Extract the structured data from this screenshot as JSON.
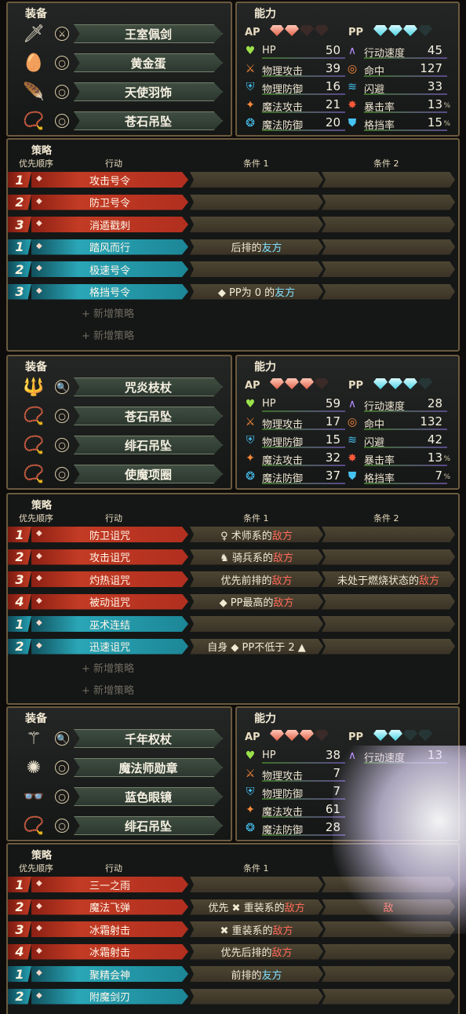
{
  "chars": [
    {
      "equip_title": "装备",
      "ability_title": "能力",
      "items": [
        {
          "icon": "sword-icon",
          "glyph": "🗡",
          "slot": "⚔",
          "name": "王室佩剑"
        },
        {
          "icon": "egg-icon",
          "glyph": "🥚",
          "slot": "○",
          "name": "黄金蛋"
        },
        {
          "icon": "feather-icon",
          "glyph": "🪶",
          "slot": "○",
          "name": "天使羽饰"
        },
        {
          "icon": "pendant-icon",
          "glyph": "📿",
          "slot": "○",
          "name": "苍石吊坠"
        }
      ],
      "ap_label": "AP",
      "pp_label": "PP",
      "ap_gems": [
        "full",
        "full",
        "empty",
        "empty"
      ],
      "pp_gems": [
        "full",
        "full",
        "full",
        "empty"
      ],
      "stats": [
        {
          "name": "HP",
          "value": "50",
          "icon": "heart-icon",
          "glyph": "♥",
          "color": "#9be24a",
          "unit": ""
        },
        {
          "name": "物理攻击",
          "value": "39",
          "icon": "sword-icon",
          "glyph": "⚔",
          "color": "#ff8a3a",
          "unit": ""
        },
        {
          "name": "物理防御",
          "value": "16",
          "icon": "armor-icon",
          "glyph": "⛨",
          "color": "#46c3f2",
          "unit": ""
        },
        {
          "name": "魔法攻击",
          "value": "21",
          "icon": "staff-icon",
          "glyph": "✦",
          "color": "#ff8a3a",
          "unit": ""
        },
        {
          "name": "魔法防御",
          "value": "20",
          "icon": "magic-shield-icon",
          "glyph": "❂",
          "color": "#46c3f2",
          "unit": ""
        },
        {
          "name": "行动速度",
          "value": "45",
          "icon": "speed-icon",
          "glyph": "∧",
          "color": "#b48cff",
          "unit": ""
        },
        {
          "name": "命中",
          "value": "127",
          "icon": "target-icon",
          "glyph": "◎",
          "color": "#ff8a3a",
          "unit": ""
        },
        {
          "name": "闪避",
          "value": "33",
          "icon": "evasion-icon",
          "glyph": "≋",
          "color": "#46c3f2",
          "unit": ""
        },
        {
          "name": "暴击率",
          "value": "13",
          "icon": "crit-icon",
          "glyph": "✸",
          "color": "#ff5a3a",
          "unit": "%"
        },
        {
          "name": "格挡率",
          "value": "15",
          "icon": "block-icon",
          "glyph": "⛊",
          "color": "#46c3f2",
          "unit": "%"
        }
      ],
      "strategy_title": "策略",
      "col_priority": "优先顺序",
      "col_action": "行动",
      "col_cond1": "条件 1",
      "col_cond2": "条件 2",
      "rows": [
        {
          "type": "red",
          "prio": "1",
          "action": "攻击号令",
          "c1": "",
          "c1hl": "",
          "c2": "",
          "c2hl": ""
        },
        {
          "type": "red",
          "prio": "2",
          "action": "防卫号令",
          "c1": "",
          "c1hl": "",
          "c2": "",
          "c2hl": ""
        },
        {
          "type": "red",
          "prio": "3",
          "action": "消遁戳刺",
          "c1": "",
          "c1hl": "",
          "c2": "",
          "c2hl": ""
        },
        {
          "type": "blue",
          "prio": "1",
          "action": "踏风而行",
          "c1": "后排的",
          "c1hl": "友方",
          "c2": "",
          "c2hl": ""
        },
        {
          "type": "blue",
          "prio": "2",
          "action": "极速号令",
          "c1": "",
          "c1hl": "",
          "c2": "",
          "c2hl": ""
        },
        {
          "type": "blue",
          "prio": "3",
          "action": "格挡号令",
          "c1": "◆ PP为 0 的",
          "c1hl": "友方",
          "c2": "",
          "c2hl": ""
        }
      ],
      "add_labels": [
        "+ 新增策略",
        "+ 新增策略"
      ]
    },
    {
      "equip_title": "装备",
      "ability_title": "能力",
      "items": [
        {
          "icon": "staff-icon",
          "glyph": "🔱",
          "slot": "🔍",
          "name": "咒炎枝杖"
        },
        {
          "icon": "pendant-icon",
          "glyph": "📿",
          "slot": "○",
          "name": "苍石吊坠"
        },
        {
          "icon": "pendant-icon",
          "glyph": "📿",
          "slot": "○",
          "name": "绯石吊坠"
        },
        {
          "icon": "necklace-icon",
          "glyph": "📿",
          "slot": "○",
          "name": "使魔项圈"
        }
      ],
      "ap_label": "AP",
      "pp_label": "PP",
      "ap_gems": [
        "full",
        "full",
        "full",
        "empty"
      ],
      "pp_gems": [
        "full",
        "full",
        "full",
        "empty"
      ],
      "stats": [
        {
          "name": "HP",
          "value": "59",
          "icon": "heart-icon",
          "glyph": "♥",
          "color": "#9be24a",
          "unit": ""
        },
        {
          "name": "物理攻击",
          "value": "17",
          "icon": "sword-icon",
          "glyph": "⚔",
          "color": "#ff8a3a",
          "unit": ""
        },
        {
          "name": "物理防御",
          "value": "15",
          "icon": "armor-icon",
          "glyph": "⛨",
          "color": "#46c3f2",
          "unit": ""
        },
        {
          "name": "魔法攻击",
          "value": "32",
          "icon": "staff-icon",
          "glyph": "✦",
          "color": "#ff8a3a",
          "unit": ""
        },
        {
          "name": "魔法防御",
          "value": "37",
          "icon": "magic-shield-icon",
          "glyph": "❂",
          "color": "#46c3f2",
          "unit": ""
        },
        {
          "name": "行动速度",
          "value": "28",
          "icon": "speed-icon",
          "glyph": "∧",
          "color": "#b48cff",
          "unit": ""
        },
        {
          "name": "命中",
          "value": "132",
          "icon": "target-icon",
          "glyph": "◎",
          "color": "#ff8a3a",
          "unit": ""
        },
        {
          "name": "闪避",
          "value": "42",
          "icon": "evasion-icon",
          "glyph": "≋",
          "color": "#46c3f2",
          "unit": ""
        },
        {
          "name": "暴击率",
          "value": "13",
          "icon": "crit-icon",
          "glyph": "✸",
          "color": "#ff5a3a",
          "unit": "%"
        },
        {
          "name": "格挡率",
          "value": "7",
          "icon": "block-icon",
          "glyph": "⛊",
          "color": "#46c3f2",
          "unit": "%"
        }
      ],
      "strategy_title": "策略",
      "col_priority": "优先顺序",
      "col_action": "行动",
      "col_cond1": "条件 1",
      "col_cond2": "条件 2",
      "rows": [
        {
          "type": "red",
          "prio": "1",
          "action": "防卫诅咒",
          "c1": "♀ 术师系的",
          "c1hl": "敌方",
          "c2": "",
          "c2hl": ""
        },
        {
          "type": "red",
          "prio": "2",
          "action": "攻击诅咒",
          "c1": "♞ 骑兵系的",
          "c1hl": "敌方",
          "c2": "",
          "c2hl": ""
        },
        {
          "type": "red",
          "prio": "3",
          "action": "灼热诅咒",
          "c1": "优先前排的",
          "c1hl": "敌方",
          "c2": "未处于燃烧状态的",
          "c2hl": "敌方"
        },
        {
          "type": "red",
          "prio": "4",
          "action": "被动诅咒",
          "c1": "◆ PP最高的",
          "c1hl": "敌方",
          "c2": "",
          "c2hl": ""
        },
        {
          "type": "blue",
          "prio": "1",
          "action": "巫术连结",
          "c1": "",
          "c1hl": "",
          "c2": "",
          "c2hl": ""
        },
        {
          "type": "blue",
          "prio": "2",
          "action": "迅速诅咒",
          "c1": "自身 ◆ PP不低于 2 ▲",
          "c1hl": "",
          "c2": "",
          "c2hl": ""
        }
      ],
      "add_labels": [
        "+ 新增策略",
        "+ 新增策略"
      ]
    },
    {
      "equip_title": "装备",
      "ability_title": "能力",
      "items": [
        {
          "icon": "staff-icon",
          "glyph": "⚚",
          "slot": "🔍",
          "name": "千年权杖"
        },
        {
          "icon": "badge-icon",
          "glyph": "✺",
          "slot": "○",
          "name": "魔法师勋章"
        },
        {
          "icon": "glasses-icon",
          "glyph": "👓",
          "slot": "○",
          "name": "蓝色眼镜"
        },
        {
          "icon": "pendant-icon",
          "glyph": "📿",
          "slot": "○",
          "name": "绯石吊坠"
        }
      ],
      "ap_label": "AP",
      "pp_label": "PP",
      "ap_gems": [
        "full",
        "full",
        "full",
        "empty"
      ],
      "pp_gems": [
        "full",
        "full",
        "empty",
        "empty"
      ],
      "stats": [
        {
          "name": "HP",
          "value": "38",
          "icon": "heart-icon",
          "glyph": "♥",
          "color": "#9be24a",
          "unit": ""
        },
        {
          "name": "物理攻击",
          "value": "7",
          "icon": "sword-icon",
          "glyph": "⚔",
          "color": "#ff8a3a",
          "unit": ""
        },
        {
          "name": "物理防御",
          "value": "7",
          "icon": "armor-icon",
          "glyph": "⛨",
          "color": "#46c3f2",
          "unit": ""
        },
        {
          "name": "魔法攻击",
          "value": "61",
          "icon": "staff-icon",
          "glyph": "✦",
          "color": "#ff8a3a",
          "unit": ""
        },
        {
          "name": "魔法防御",
          "value": "28",
          "icon": "magic-shield-icon",
          "glyph": "❂",
          "color": "#46c3f2",
          "unit": ""
        },
        {
          "name": "行动速度",
          "value": "13",
          "icon": "speed-icon",
          "glyph": "∧",
          "color": "#b48cff",
          "unit": ""
        }
      ],
      "strategy_title": "策略",
      "col_priority": "优先顺序",
      "col_action": "行动",
      "col_cond1": "条件 1",
      "col_cond2": "",
      "rows": [
        {
          "type": "red",
          "prio": "1",
          "action": "三一之雨",
          "c1": "",
          "c1hl": "",
          "c2": "",
          "c2hl": ""
        },
        {
          "type": "red",
          "prio": "2",
          "action": "魔法飞弹",
          "c1": "优先 ✖ 重装系的",
          "c1hl": "敌方",
          "c2": "",
          "c2hl": "敌"
        },
        {
          "type": "red",
          "prio": "3",
          "action": "冰霜射击",
          "c1": "✖ 重装系的",
          "c1hl": "敌方",
          "c2": "",
          "c2hl": ""
        },
        {
          "type": "red",
          "prio": "4",
          "action": "冰霜射击",
          "c1": "优先后排的",
          "c1hl": "敌方",
          "c2": "",
          "c2hl": ""
        },
        {
          "type": "blue",
          "prio": "1",
          "action": "聚精会神",
          "c1": "前排的",
          "c1hl": "友方",
          "c2": "",
          "c2hl": ""
        },
        {
          "type": "blue",
          "prio": "2",
          "action": "附魔剑刃",
          "c1": "",
          "c1hl": "",
          "c2": "",
          "c2hl": ""
        }
      ],
      "add_labels": []
    }
  ]
}
